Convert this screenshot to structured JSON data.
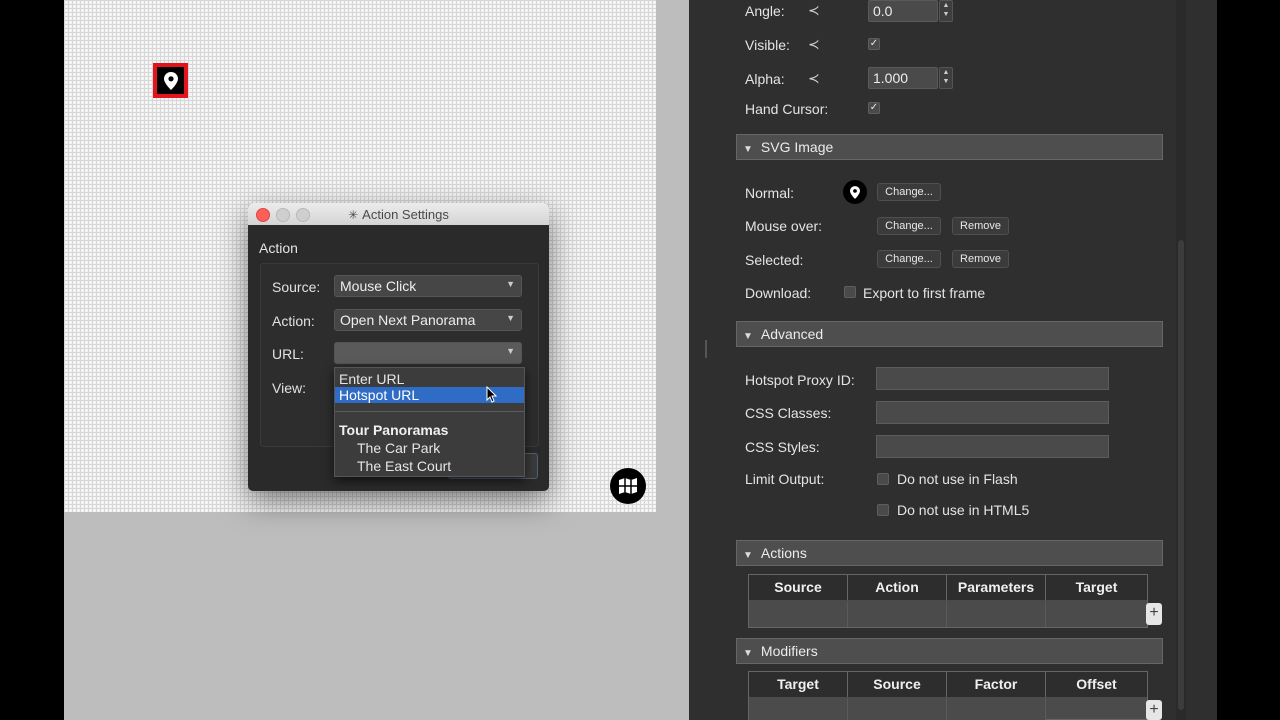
{
  "dialog": {
    "title": "Action Settings",
    "section_label": "Action",
    "source_label": "Source:",
    "source_value": "Mouse Click",
    "action_label": "Action:",
    "action_value": "Open Next Panorama",
    "url_label": "URL:",
    "url_value": "",
    "view_label": "View:",
    "popup": {
      "items": [
        "Enter URL",
        "Hotspot URL"
      ],
      "selected": "Hotspot URL",
      "group_header": "Tour Panoramas",
      "group_items": [
        "The Car Park",
        "The East Court"
      ]
    }
  },
  "panel": {
    "angle_label": "Angle:",
    "angle_value": "0.0",
    "visible_label": "Visible:",
    "alpha_label": "Alpha:",
    "alpha_value": "1.000",
    "hand_cursor_label": "Hand Cursor:",
    "svg_section": "SVG Image",
    "normal_label": "Normal:",
    "mouse_over_label": "Mouse over:",
    "selected_label": "Selected:",
    "download_label": "Download:",
    "export_label": "Export to first frame",
    "change_label": "Change...",
    "remove_label": "Remove",
    "advanced_section": "Advanced",
    "proxy_label": "Hotspot Proxy ID:",
    "css_classes_label": "CSS Classes:",
    "css_styles_label": "CSS Styles:",
    "limit_output_label": "Limit Output:",
    "no_flash_label": "Do not use in Flash",
    "no_html5_label": "Do not use in HTML5",
    "actions_section": "Actions",
    "actions_columns": [
      "Source",
      "Action",
      "Parameters",
      "Target"
    ],
    "modifiers_section": "Modifiers",
    "modifiers_columns": [
      "Target",
      "Source",
      "Factor",
      "Offset"
    ],
    "plus_label": "+"
  },
  "colors": {
    "hotspot_highlight": "#e3141c",
    "selection_blue": "#2f6cc5",
    "panel_bg": "#2f2f2f"
  }
}
